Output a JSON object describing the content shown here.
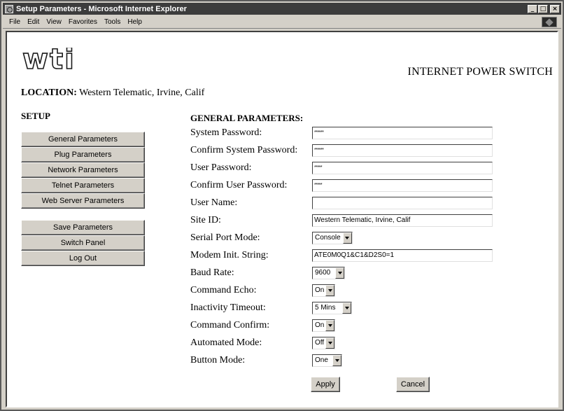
{
  "window": {
    "title": "Setup Parameters - Microsoft Internet Explorer",
    "buttons": {
      "minimize": "_",
      "maximize": "□",
      "close": "×"
    }
  },
  "menubar": [
    {
      "label": "File"
    },
    {
      "label": "Edit"
    },
    {
      "label": "View"
    },
    {
      "label": "Favorites"
    },
    {
      "label": "Tools"
    },
    {
      "label": "Help"
    }
  ],
  "header": {
    "logo_text": "wti",
    "product_title": "INTERNET POWER SWITCH",
    "location_label": "LOCATION:",
    "location_value": "Western Telematic, Irvine, Calif"
  },
  "sidebar": {
    "heading": "SETUP",
    "group1": [
      {
        "label": "General Parameters"
      },
      {
        "label": "Plug Parameters"
      },
      {
        "label": "Network Parameters"
      },
      {
        "label": "Telnet Parameters"
      },
      {
        "label": "Web Server Parameters"
      }
    ],
    "group2": [
      {
        "label": "Save Parameters"
      },
      {
        "label": "Switch Panel"
      },
      {
        "label": "Log Out"
      }
    ]
  },
  "form": {
    "heading": "GENERAL PARAMETERS:",
    "fields": [
      {
        "label": "System Password:",
        "value": "******"
      },
      {
        "label": "Confirm System Password:",
        "value": "******"
      },
      {
        "label": "User Password:",
        "value": "*****"
      },
      {
        "label": "Confirm User Password:",
        "value": "*****"
      },
      {
        "label": "User Name:",
        "value": ""
      },
      {
        "label": "Site ID:",
        "value": "Western Telematic, Irvine, Calif"
      },
      {
        "label": "Serial Port Mode:",
        "value": "Console"
      },
      {
        "label": "Modem Init. String:",
        "value": "ATE0M0Q1&C1&D2S0=1"
      },
      {
        "label": "Baud Rate:",
        "value": "9600"
      },
      {
        "label": "Command Echo:",
        "value": "On"
      },
      {
        "label": "Inactivity Timeout:",
        "value": "5 Mins"
      },
      {
        "label": "Command Confirm:",
        "value": "On"
      },
      {
        "label": "Automated Mode:",
        "value": "Off"
      },
      {
        "label": "Button Mode:",
        "value": "One"
      }
    ],
    "apply_label": "Apply",
    "cancel_label": "Cancel"
  },
  "colors": {
    "titlebar": "#3c3c3c",
    "chrome": "#d4d0c8",
    "page": "#ffffff"
  }
}
